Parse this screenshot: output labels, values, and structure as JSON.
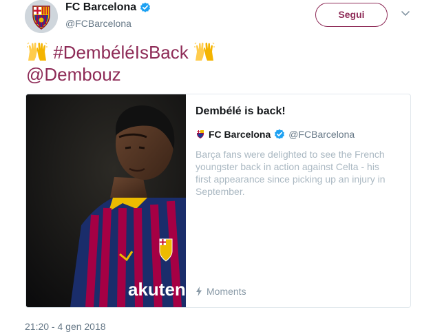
{
  "account": {
    "display_name": "FC Barcelona",
    "handle": "@FCBarcelona",
    "avatar_icon": "fcb-crest-icon",
    "verified_icon": "verified-badge-icon",
    "verified_color": "#1da1f2"
  },
  "follow_button": {
    "label": "Segui",
    "color": "#8e2b57"
  },
  "more_icon": "chevron-down-icon",
  "tweet": {
    "emoji_left": "raising-hands-emoji",
    "hashtag": "#DembéléIsBack",
    "emoji_right": "raising-hands-emoji",
    "mention": "@Dembouz",
    "link_color": "#8e2b57"
  },
  "moment_card": {
    "image_icon": "player-photo",
    "title": "Dembélé is back!",
    "author_name": "FC Barcelona",
    "author_handle": "@FCBarcelona",
    "description": "Barça fans were delighted to see the French youngster back in action against Celta - his first appearance since picking up an injury in September.",
    "footer_icon": "lightning-bolt-icon",
    "footer_label": "Moments"
  },
  "timestamp": "21:20 - 4 gen 2018"
}
